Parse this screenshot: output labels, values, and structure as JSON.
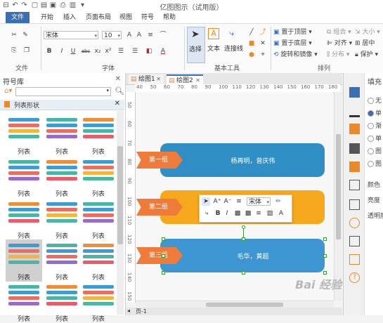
{
  "app": {
    "title": "亿图图示（试用版）"
  },
  "menu": {
    "tabs": [
      "文件",
      "开始",
      "插入",
      "页面布局",
      "视图",
      "符号",
      "帮助"
    ]
  },
  "ribbon": {
    "groups": {
      "file": "文件",
      "font": "字体",
      "basic_tools": "基本工具",
      "arrange": "排列"
    },
    "font_name": "宋体",
    "font_size": "10",
    "select_label": "选择",
    "text_label": "文本",
    "connector_label": "连接线",
    "bring_front": "置于顶层",
    "send_back": "置于底层",
    "rotate_mirror": "旋转和镜像",
    "group": "组合",
    "align": "对齐",
    "distribute": "分布",
    "size": "大小",
    "center": "居中",
    "protect": "保护",
    "format_buttons": [
      "B",
      "I",
      "U",
      "abc",
      "x₂",
      "x²"
    ]
  },
  "library": {
    "title": "符号库",
    "category": "列表形状",
    "item_label": "列表",
    "rows": 5,
    "cols": 3
  },
  "doc_tabs": [
    {
      "label": "绘图1"
    },
    {
      "label": "绘图2"
    }
  ],
  "hruler_ticks": [
    "40",
    "50",
    "60",
    "70",
    "80",
    "90",
    "100",
    "110",
    "120",
    "130",
    "140",
    "150",
    "160",
    "170",
    "180"
  ],
  "vruler_ticks": [
    "50",
    "60",
    "70",
    "80",
    "90",
    "100",
    "110",
    "120",
    "130",
    "140",
    "150"
  ],
  "diagram": {
    "rows": [
      {
        "tag": "第一组",
        "text": "杨再明，曾庆伟",
        "band_color": "#2f8fc4",
        "tag_color": "#ef7b3a"
      },
      {
        "tag": "第二组",
        "text": "",
        "band_color": "#f6a81c",
        "tag_color": "#ef7b3a"
      },
      {
        "tag": "第三组",
        "text": "毛华，黄超",
        "band_color": "#3d96d2",
        "tag_color": "#ef7b3a"
      }
    ]
  },
  "floatbar": {
    "font": "宋体",
    "buttons_row1": [
      "A⁺",
      "A⁻",
      "≡",
      "✏"
    ],
    "buttons_row2": [
      "B",
      "I",
      "≡",
      "A"
    ]
  },
  "fill_panel": {
    "title": "填充",
    "options": [
      "无",
      "单",
      "渐",
      "单",
      "图",
      "图"
    ],
    "labels": {
      "color": "颜色",
      "brightness": "亮度",
      "transparency": "透明度"
    }
  },
  "status": {
    "page": "页-1"
  },
  "watermark": "Bai 经验"
}
